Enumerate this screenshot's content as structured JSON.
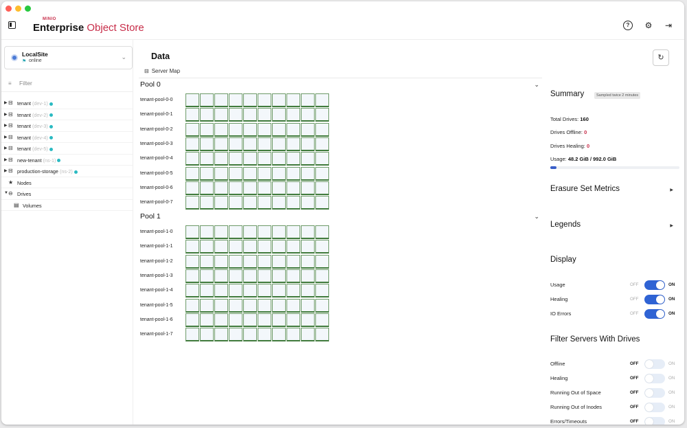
{
  "brand": {
    "small": "MINIO",
    "name_bold": "Enterprise",
    "name_light": "Object Store"
  },
  "colors": {
    "accent": "#c72c48",
    "toggle_on": "#2f63d4",
    "drive_border": "#3f7a3b",
    "online_dot": "#2bbac2"
  },
  "topbar_icons": [
    "sidebar-toggle-icon",
    "help-icon",
    "gear-icon",
    "logout-icon"
  ],
  "site": {
    "name": "LocalSite",
    "status": "online"
  },
  "filter": {
    "placeholder": "Filter"
  },
  "tree": [
    {
      "label": "tenant",
      "sub": "(dev-1)"
    },
    {
      "label": "tenant",
      "sub": "(dev-2)"
    },
    {
      "label": "tenant",
      "sub": "(dev-3)"
    },
    {
      "label": "tenant",
      "sub": "(dev-4)"
    },
    {
      "label": "tenant",
      "sub": "(dev-5)"
    },
    {
      "label": "new-tenant",
      "sub": "(ns-1)"
    },
    {
      "label": "production-storage",
      "sub": "(ns-2)"
    },
    {
      "label": "Nodes"
    },
    {
      "label": "Drives"
    },
    {
      "label": "Volumes"
    }
  ],
  "main": {
    "title": "Data",
    "server_map": "Server Map",
    "pools": [
      {
        "title": "Pool 0",
        "rows": [
          "tenant-pool-0-0",
          "tenant-pool-0-1",
          "tenant-pool-0-2",
          "tenant-pool-0-3",
          "tenant-pool-0-4",
          "tenant-pool-0-5",
          "tenant-pool-0-6",
          "tenant-pool-0-7"
        ]
      },
      {
        "title": "Pool 1",
        "rows": [
          "tenant-pool-1-0",
          "tenant-pool-1-1",
          "tenant-pool-1-2",
          "tenant-pool-1-3",
          "tenant-pool-1-4",
          "tenant-pool-1-5",
          "tenant-pool-1-6",
          "tenant-pool-1-7"
        ]
      }
    ],
    "drives_per_row": 10
  },
  "summary": {
    "title": "Summary",
    "badge": "Sampled twice 2 minutes",
    "total_drives_label": "Total Drives:",
    "total_drives": "160",
    "drives_offline_label": "Drives Offline:",
    "drives_offline": "0",
    "drives_healing_label": "Drives Healing:",
    "drives_healing": "0",
    "usage_label": "Usage:",
    "usage": "48.2 GiB / 992.0 GiB",
    "usage_fraction": 0.0486
  },
  "sections": {
    "erasure": "Erasure Set Metrics",
    "legends": "Legends",
    "display": "Display",
    "filter_servers": "Filter Servers With Drives"
  },
  "toggle_text": {
    "off": "OFF",
    "on": "ON"
  },
  "display_toggles": [
    {
      "label": "Usage",
      "on": true
    },
    {
      "label": "Healing",
      "on": true
    },
    {
      "label": "IO Errors",
      "on": true
    }
  ],
  "filter_toggles": [
    {
      "label": "Offline",
      "on": false
    },
    {
      "label": "Healing",
      "on": false
    },
    {
      "label": "Running Out of Space",
      "on": false
    },
    {
      "label": "Running Out of Inodes",
      "on": false
    },
    {
      "label": "Errors/Timeouts",
      "on": false
    }
  ]
}
